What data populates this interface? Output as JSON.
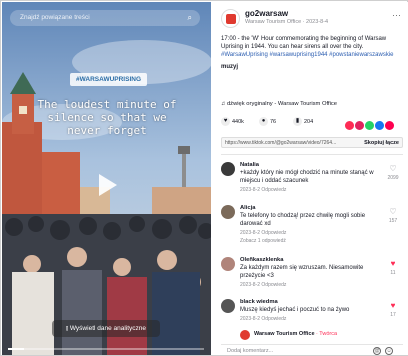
{
  "video": {
    "search_placeholder": "Znajdź powiązane treści",
    "hashtag": "#WARSAWUPRISING",
    "overlay_text": "The loudest minute of silence so that we never forget",
    "analytics_button": "Wyświetl dane analityczne",
    "progress_fraction": 0.08
  },
  "post": {
    "username": "go2warsaw",
    "meta": "Warsaw Tourism Office · 2023-8-4",
    "description": "17:00 - the 'W' Hour commemorating the beginning of Warsaw Uprising in 1944. You can hear sirens all over the city.",
    "hashtags": "#WarsawUprising #warsawuprising1944 #powstaniewarszawskie",
    "music_label": "muzyj",
    "sound": "♫ dźwięk oryginalny - Warsaw Tourism Office",
    "likes": "440k",
    "comments": "76",
    "saves": "204",
    "link": "https://www.tiktok.com/@go2warsaw/video/7264...",
    "copy_label": "Skopiuj łącze",
    "share_colors": [
      "#fe2c55",
      "#e0245e",
      "#25d366",
      "#1877f2",
      "#ff0050"
    ]
  },
  "comments": [
    {
      "name": "Natalia",
      "text": "+każdy który nie mógł chodzić na minute stanąć w miejscu i oddać szacunek",
      "date": "2023-8-2 Odpowiedz",
      "likes": "2099",
      "liked": false,
      "replies": ""
    },
    {
      "name": "Alicja",
      "text": "Te telefony to chodzą! przez chwilę mogli sobie darować xd",
      "date": "2023-8-2 Odpowiedz",
      "likes": "157",
      "liked": false,
      "replies": "Zobacz 1 odpowiedź"
    },
    {
      "name": "Oleñkaszklenka",
      "text": "Za każdym razem się wzruszam. Niesamowite przeżycie <3",
      "date": "2023-8-2 Odpowiedz",
      "likes": "11",
      "liked": true,
      "replies": ""
    },
    {
      "name": "black wiedma",
      "text": "Muszę kiedyś jechać i poczuć to na żywo",
      "date": "2023-8-2 Odpowiedz",
      "likes": "17",
      "liked": true,
      "replies": ""
    }
  ],
  "reply": {
    "name": "Warsaw Tourism Office",
    "tag": "· Twórca"
  },
  "input": {
    "placeholder": "Dodaj komentarz..."
  }
}
